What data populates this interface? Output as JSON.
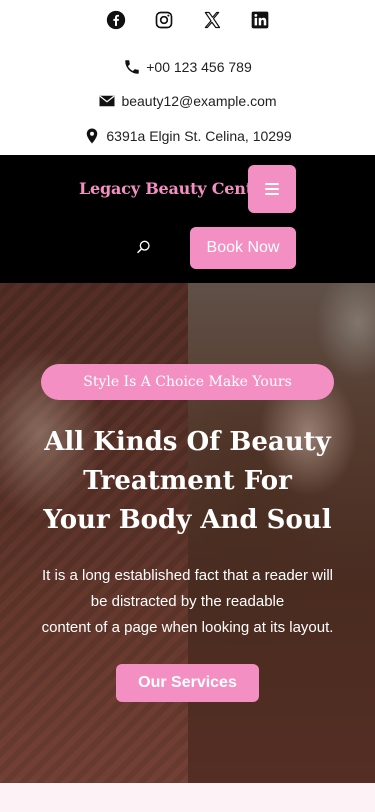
{
  "social": {
    "items": [
      {
        "icon": "facebook-icon"
      },
      {
        "icon": "instagram-icon"
      },
      {
        "icon": "x-twitter-icon"
      },
      {
        "icon": "linkedin-icon"
      }
    ]
  },
  "contact": {
    "phone": "+00 123 456 789",
    "email": "beauty12@example.com",
    "address": "6391a Elgin St. Celina, 10299"
  },
  "header": {
    "brand": "Legacy Beauty Center",
    "menu_icon": "hamburger-menu-icon",
    "search_icon": "search-icon",
    "book_label": "Book Now"
  },
  "hero": {
    "tagline": "Style Is A Choice Make Yours",
    "title_lines": [
      "All Kinds Of Beauty",
      "Treatment For",
      "Your Body And Soul"
    ],
    "text_lines": [
      "It is a long established fact that a reader will",
      "be distracted by the readable",
      "content of a page when looking at its layout."
    ],
    "cta_label": "Our Services"
  },
  "colors": {
    "accent": "#f48fc4",
    "header_bg": "#000000",
    "strip_bg": "#fdf3f6"
  }
}
